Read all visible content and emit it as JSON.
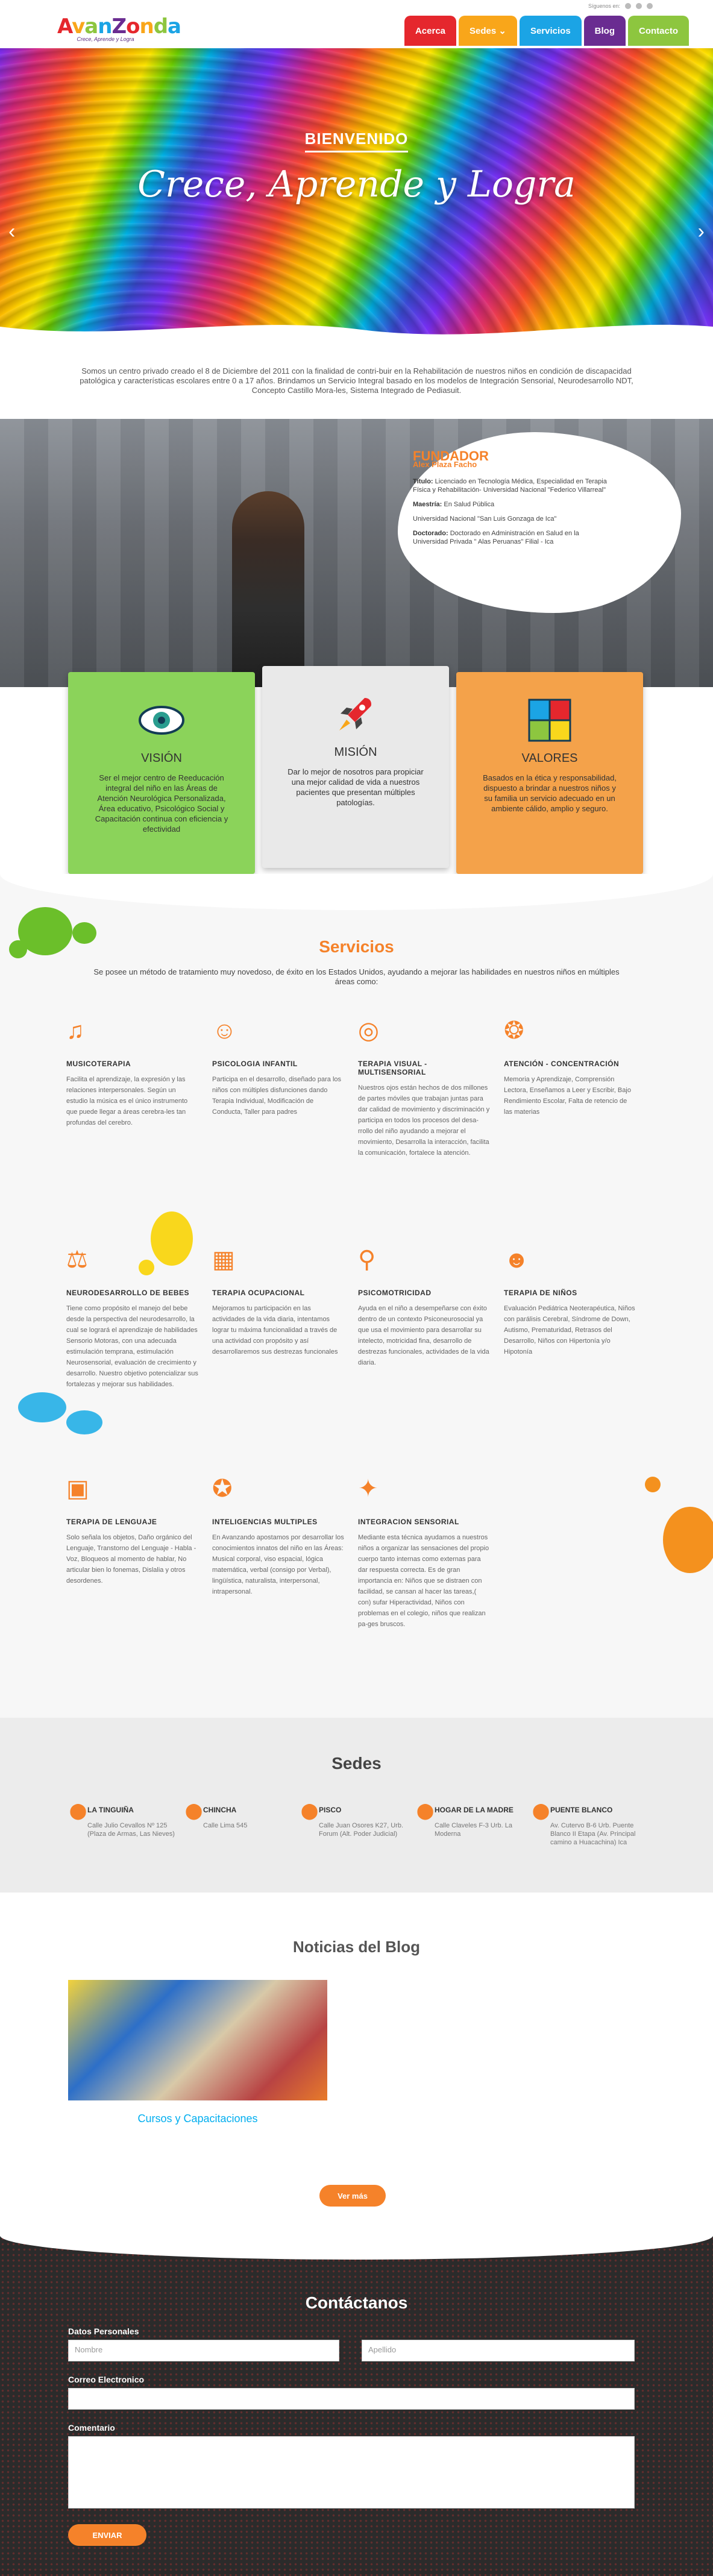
{
  "topbar": {
    "label": "Síguenos en:"
  },
  "logo": {
    "text": "AvanZonda",
    "tagline": "Crece, Aprende y Logra"
  },
  "nav": [
    {
      "label": "Acerca",
      "color": "#e5272d"
    },
    {
      "label": "Sedes ⌄",
      "color": "#f9a61a"
    },
    {
      "label": "Servicios",
      "color": "#1ba4e5"
    },
    {
      "label": "Blog",
      "color": "#6a2c91"
    },
    {
      "label": "Contacto",
      "color": "#8dc63f"
    }
  ],
  "hero": {
    "kicker": "BIENVENIDO",
    "title": "Crece, Aprende y Logra"
  },
  "intro": "Somos un centro privado creado el 8 de Diciembre del 2011 con la finalidad de contri-buir en la Rehabilitación de nuestros niños en condición de discapacidad patológica y características escolares entre 0 a 17 años. Brindamos un Servicio Integral basado en los modelos de Integración Sensorial, Neurodesarrollo NDT, Concepto Castillo Mora-les, Sistema Integrado de Pediasuit.",
  "founder": {
    "heading": "FUNDADOR",
    "name": "Alex Plaza Facho",
    "items": [
      {
        "k": "Título:",
        "v": "Licenciado en Tecnología Médica, Especialidad en Terapia Física y Rehabilitación- Universidad Nacional \"Federico Villarreal\""
      },
      {
        "k": "Maestría:",
        "v": "En Salud Pública"
      },
      {
        "k": "",
        "v": "Universidad Nacional \"San Luis Gonzaga de Ica\""
      },
      {
        "k": "Doctorado:",
        "v": "Doctorado en Administración en Salud en la Universidad Privada \" Alas Peruanas\" Filial - Ica"
      }
    ]
  },
  "cards": [
    {
      "title": "VISIÓN",
      "icon": "eye-icon",
      "glyph": "◉",
      "bg": "#8bd35a",
      "text": "Ser el mejor centro de Reeducación integral del niño en las Áreas de Atención Neurológica Personalizada, Área educativo, Psicológico Social y Capacitación continua con eficiencia y efectividad"
    },
    {
      "title": "MISIÓN",
      "icon": "rocket-icon",
      "glyph": "🚀",
      "bg": "#e9e9e9",
      "text": "Dar lo mejor de nosotros para propiciar una mejor calidad de vida a nuestros pacientes que presentan múltiples patologías."
    },
    {
      "title": "VALORES",
      "icon": "puzzle-icon",
      "glyph": "🧩",
      "bg": "#f4a24a",
      "text": "Basados en la ética y responsabilidad, dispuesto a brindar a nuestros niños y su familia un servicio adecuado en un ambiente cálido, amplio y seguro."
    }
  ],
  "services": {
    "title": "Servicios",
    "subtitle": "Se posee un método de tratamiento muy novedoso, de éxito en los Estados Unidos, ayudando a mejorar las habilidades en nuestros niños en múltiples áreas como:",
    "items": [
      {
        "title": "MUSICOTERAPIA",
        "icon": "guitar-icon",
        "glyph": "♫",
        "text": "Facilita el aprendizaje, la expresión y las relaciones interpersonales. Según un estudio la música es el único instrumento que puede llegar a áreas cerebra-les tan profundas del cerebro."
      },
      {
        "title": "PSICOLOGIA INFANTIL",
        "icon": "head-icon",
        "glyph": "☺",
        "text": "Participa en el desarrollo, diseñado para los niños con múltiples disfunciones dando Terapia Individual, Modificación de Conducta, Taller para padres"
      },
      {
        "title": "TERAPIA VISUAL - MULTISENSORIAL",
        "icon": "eye-icon",
        "glyph": "◎",
        "text": "Nuestros ojos están hechos de dos millones de partes móviles que trabajan juntas para dar calidad de movimiento y discriminación y participa en todos los procesos del desa-rrollo del niño ayudando a mejorar el movimiento, Desarrolla la interacción, facilita la comunicación, fortalece la atención."
      },
      {
        "title": "ATENCIÓN - CONCENTRACIÓN",
        "icon": "brain-icon",
        "glyph": "❂",
        "text": "Memoria y Aprendizaje, Comprensión Lectora, Enseñamos a Leer y Escribir, Bajo Rendimiento Escolar, Falta de retencio de las materias"
      },
      {
        "title": "NEURODESARROLLO DE BEBES",
        "icon": "mobile-toy-icon",
        "glyph": "⚖",
        "text": "Tiene como propósito el manejo del bebe desde la perspectiva del neurodesarrollo, la cual se logrará el aprendizaje de habilidades Sensorio Motoras, con una adecuada estimulación temprana, estimulación Neurosensorial, evaluación de crecimiento y desarrollo. Nuestro objetivo potencializar sus fortalezas y mejorar sus habilidades."
      },
      {
        "title": "TERAPIA OCUPACIONAL",
        "icon": "blocks-icon",
        "glyph": "▦",
        "text": "Mejoramos tu participación en las actividades de la vida diaria, intentamos lograr tu máxima funcionalidad a través de una actividad con propósito y así desarrollaremos sus destrezas funcionales"
      },
      {
        "title": "PSICOMOTRICIDAD",
        "icon": "bicycle-icon",
        "glyph": "⚲",
        "text": "Ayuda en el niño a desempeñarse con éxito dentro de un contexto Psiconeurosocial ya que usa el movimiento para desarrollar su intelecto, motricidad fina, desarrollo de destrezas funcionales, actividades de la vida diaria."
      },
      {
        "title": "TERAPIA DE NIÑOS",
        "icon": "children-icon",
        "glyph": "☻",
        "text": "Evaluación Pediátrica Neoterapéutica, Niños con parálisis Cerebral, Síndrome de Down, Autismo, Prematuridad, Retrasos del Desarrollo, Niños con Hipertonía y/o Hipotonía"
      },
      {
        "title": "TERAPIA DE LENGUAJE",
        "icon": "abc-blocks-icon",
        "glyph": "▣",
        "text": "Solo señala los objetos, Daño orgánico del Lenguaje, Transtorno del Lenguaje - Habla - Voz, Bloqueos al momento de hablar, No articular bien lo fonemas, Dislalia y otros desorde­nes."
      },
      {
        "title": "INTELIGENCIAS MULTIPLES",
        "icon": "lightbulb-head-icon",
        "glyph": "✪",
        "text": "En Avanzando apostamos por desarrollar los conocimientos innatos del niño en las Áreas: Musical corporal, viso espacial, lógica matemática, verbal (consigo por Verbal), lingüística, naturalista, interpersonal, intrapersonal."
      },
      {
        "title": "INTEGRACION SENSORIAL",
        "icon": "sensory-icon",
        "glyph": "✦",
        "text": "Mediante esta técnica ayudamos a nuestros niños a organizar las sensaciones del propio cuerpo tanto internas como externas para dar respuesta correcta. Es de gran importancia en: Niños que se distraen con facilidad, se cansan al hacer las tareas,( con) sufar Hiperactividad, Niños con problemas en el colegio, niños que realizan pa-ges bruscos."
      }
    ]
  },
  "sedes": {
    "title": "Sedes",
    "items": [
      {
        "name": "LA TINGUIÑA",
        "addr": "Calle Julio Cevallos Nº 125 (Plaza de Armas, Las Nieves)"
      },
      {
        "name": "CHINCHA",
        "addr": "Calle Lima 545"
      },
      {
        "name": "PISCO",
        "addr": "Calle Juan Osores K27, Urb. Forum (Alt. Poder Judicial)"
      },
      {
        "name": "HOGAR DE LA MADRE",
        "addr": "Calle Claveles F-3 Urb. La Moderna"
      },
      {
        "name": "PUENTE BLANCO",
        "addr": "Av. Cutervo B-6 Urb. Puente Blanco II Etapa (Av. Principal camino a Huacachina) Ica"
      }
    ]
  },
  "blog": {
    "title": "Noticias del Blog",
    "caption": "Cursos y Capacitaciones",
    "more": "Ver más"
  },
  "contact": {
    "title": "Contáctanos",
    "personal_label": "Datos Personales",
    "first_name_ph": "Nombre",
    "last_name_ph": "Apellido",
    "email_label": "Correo Electronico",
    "comment_label": "Comentario",
    "send": "ENVIAR"
  }
}
